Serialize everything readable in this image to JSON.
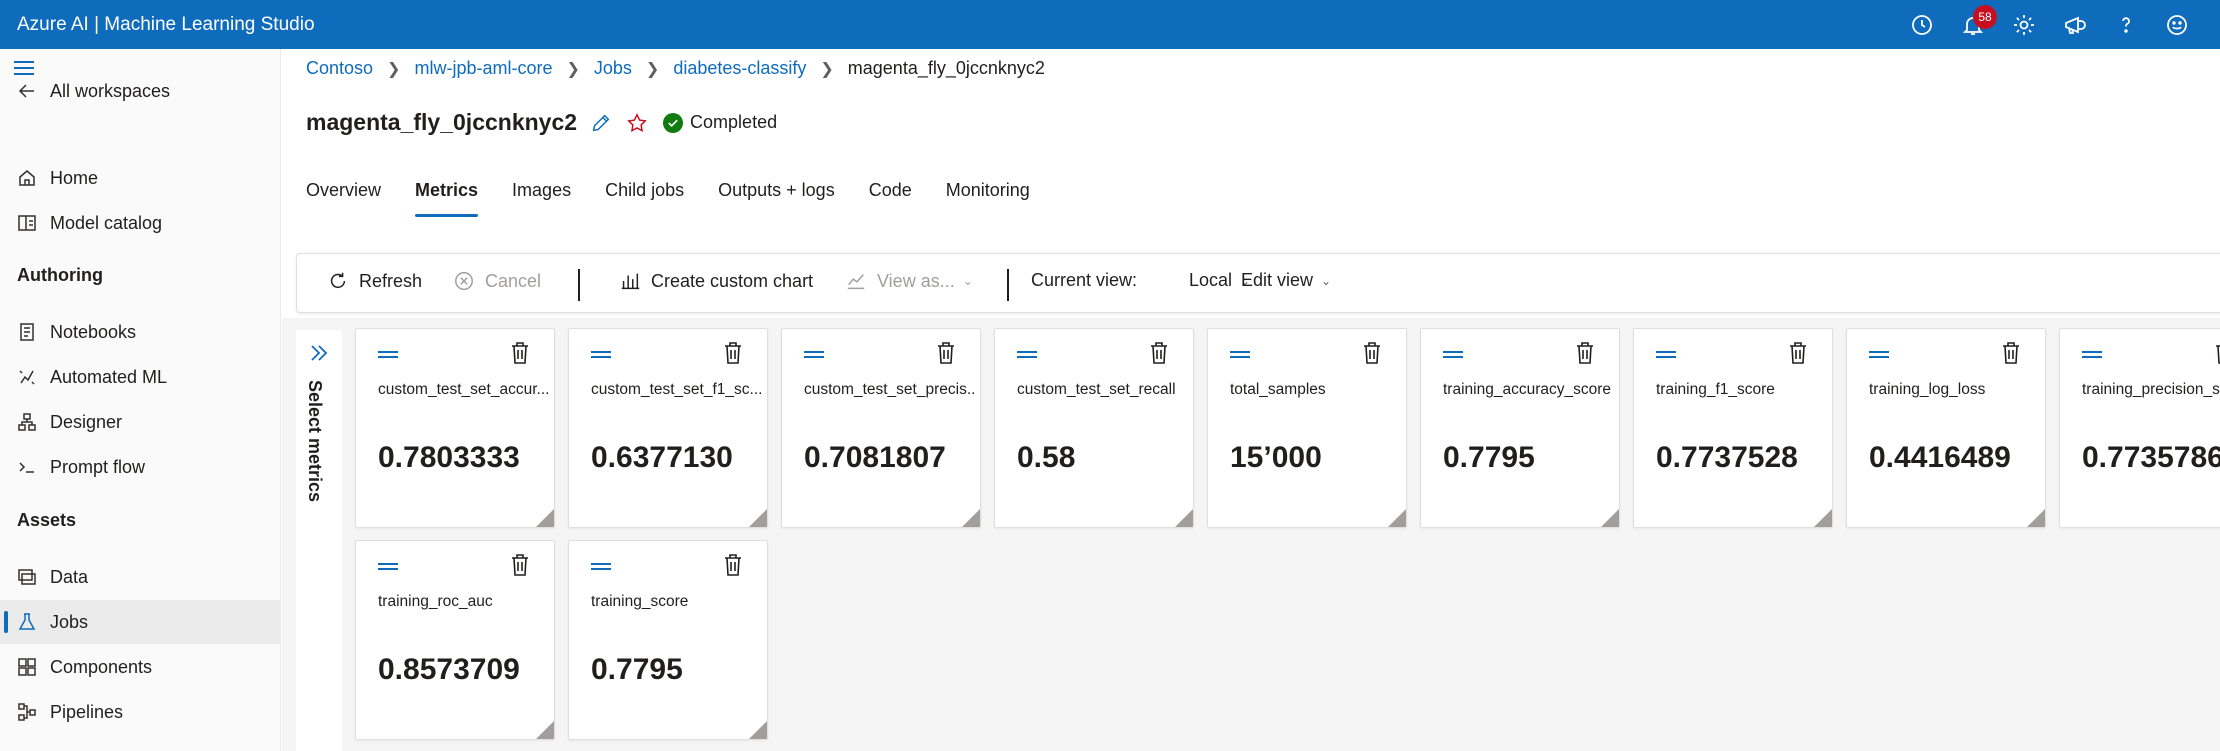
{
  "app": {
    "title": "Azure AI | Machine Learning Studio",
    "notification_count": "58"
  },
  "top_icons": [
    "clock-icon",
    "bell-icon",
    "gear-icon",
    "megaphone-icon",
    "help-icon",
    "smiley-icon"
  ],
  "sidebar": {
    "all_workspaces": "All workspaces",
    "items_top": [
      {
        "label": "Home",
        "icon": "home-icon"
      },
      {
        "label": "Model catalog",
        "icon": "catalog-icon"
      }
    ],
    "authoring_label": "Authoring",
    "authoring_items": [
      {
        "label": "Notebooks",
        "icon": "notebook-icon"
      },
      {
        "label": "Automated ML",
        "icon": "automl-icon"
      },
      {
        "label": "Designer",
        "icon": "designer-icon"
      },
      {
        "label": "Prompt flow",
        "icon": "prompt-icon"
      }
    ],
    "assets_label": "Assets",
    "assets_items": [
      {
        "label": "Data",
        "icon": "data-icon"
      },
      {
        "label": "Jobs",
        "icon": "jobs-icon",
        "active": true
      },
      {
        "label": "Components",
        "icon": "components-icon"
      },
      {
        "label": "Pipelines",
        "icon": "pipelines-icon"
      }
    ]
  },
  "breadcrumb": {
    "items": [
      "Contoso",
      "mlw-jpb-aml-core",
      "Jobs",
      "diabetes-classify"
    ],
    "current": "magenta_fly_0jccnknyc2"
  },
  "job": {
    "title": "magenta_fly_0jccnknyc2",
    "status": "Completed",
    "status_color": "#107c10"
  },
  "tabs": [
    "Overview",
    "Metrics",
    "Images",
    "Child jobs",
    "Outputs + logs",
    "Code",
    "Monitoring"
  ],
  "active_tab": "Metrics",
  "toolbar": {
    "refresh": "Refresh",
    "cancel": "Cancel",
    "create_chart": "Create custom chart",
    "view_as": "View as...",
    "current_view_label": "Current view:",
    "current_view_value": "Local",
    "edit_view": "Edit view"
  },
  "select_metrics_label": "Select metrics",
  "metrics": [
    {
      "name": "custom_test_set_accur...",
      "value": "0.7803333"
    },
    {
      "name": "custom_test_set_f1_sc...",
      "value": "0.6377130"
    },
    {
      "name": "custom_test_set_precis...",
      "value": "0.7081807"
    },
    {
      "name": "custom_test_set_recall",
      "value": "0.58"
    },
    {
      "name": "total_samples",
      "value": "15’000"
    },
    {
      "name": "training_accuracy_score",
      "value": "0.7795"
    },
    {
      "name": "training_f1_score",
      "value": "0.7737528"
    },
    {
      "name": "training_log_loss",
      "value": "0.4416489"
    },
    {
      "name": "training_precision_sco",
      "value": "0.7735786"
    },
    {
      "name": "training_roc_auc",
      "value": "0.8573709"
    },
    {
      "name": "training_score",
      "value": "0.7795"
    }
  ],
  "colors": {
    "accent": "#0f6cbd",
    "topbar": "#0f6cbd",
    "badge": "#c50f1f"
  }
}
